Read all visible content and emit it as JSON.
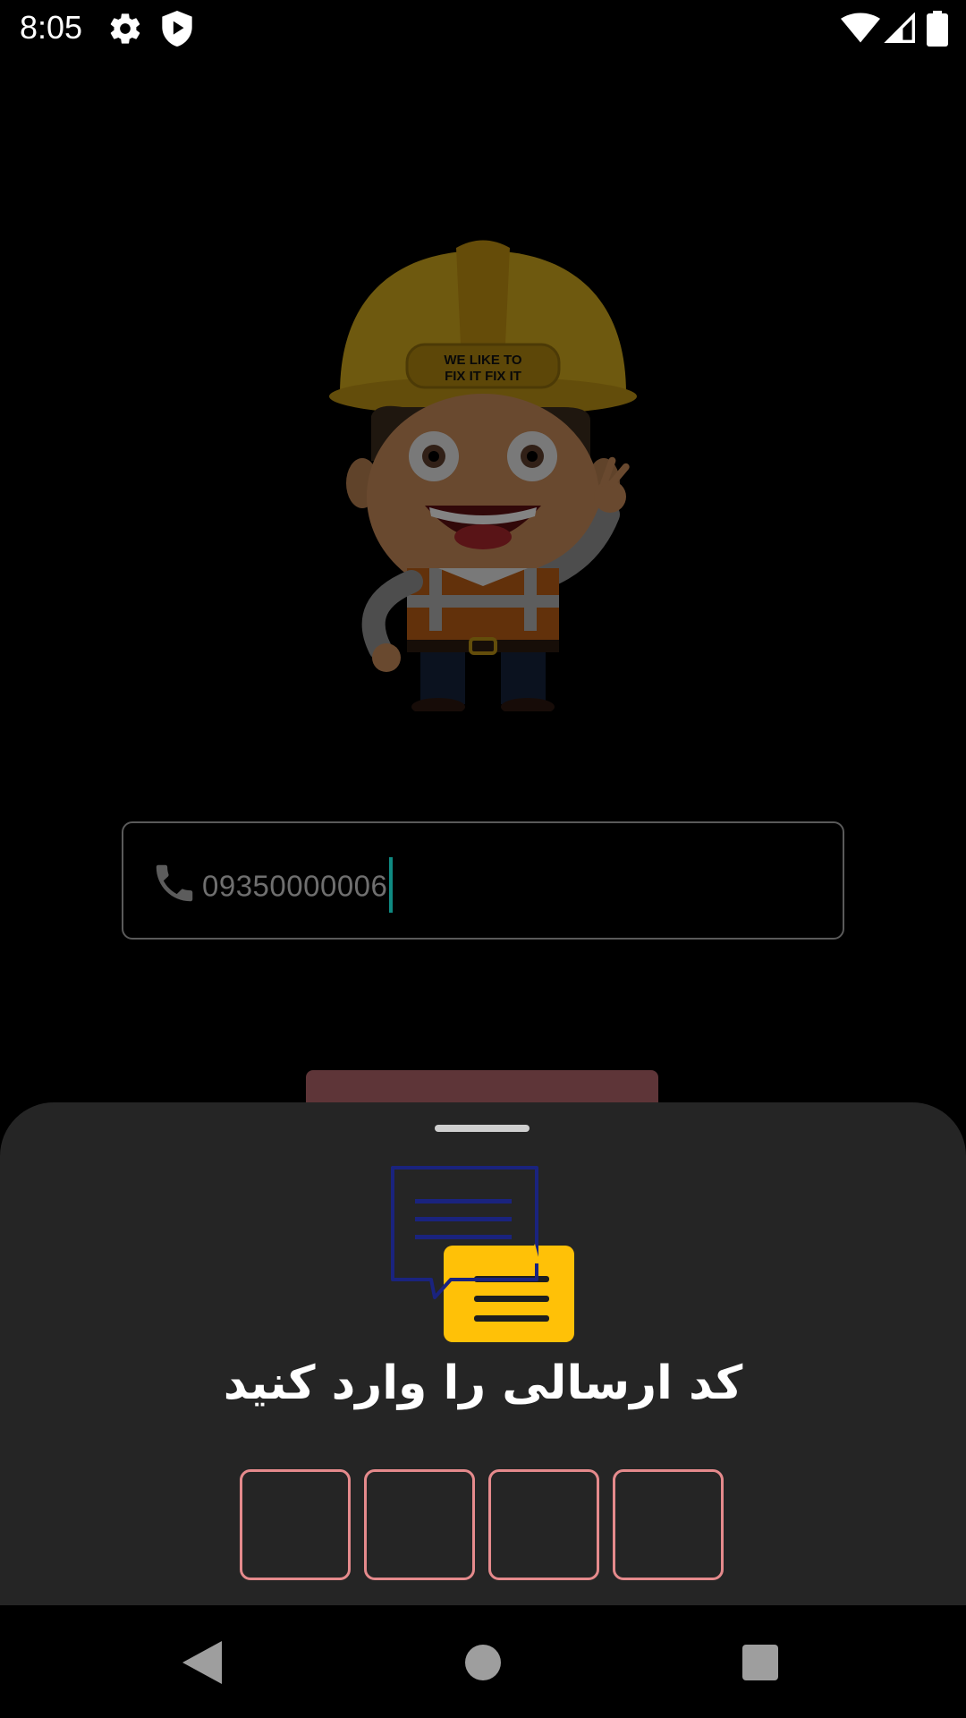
{
  "status_bar": {
    "time": "8:05",
    "icons": [
      "gear-icon",
      "shield-icon",
      "wifi-icon",
      "signal-icon",
      "battery-icon"
    ]
  },
  "mascot": {
    "helmet_text_line1": "WE LIKE TO",
    "helmet_text_line2": "FIX IT FIX IT"
  },
  "phone_field": {
    "icon": "phone-icon",
    "value": "09350000006"
  },
  "submit_button": {
    "label": "..."
  },
  "bottom_sheet": {
    "icon": "sms-chat-icon",
    "title": "کد ارسالی را وارد کنید",
    "otp_digits": [
      "",
      "",
      "",
      ""
    ]
  },
  "nav_bar": {
    "icons": [
      "back-icon",
      "home-icon",
      "recents-icon"
    ]
  },
  "colors": {
    "background": "#000000",
    "sheet": "#252525",
    "otp_border": "#e58a8c",
    "caret": "#0f8a82",
    "button": "#5e3538",
    "sms_yellow": "#ffc107",
    "sms_navy": "#1a237e"
  }
}
